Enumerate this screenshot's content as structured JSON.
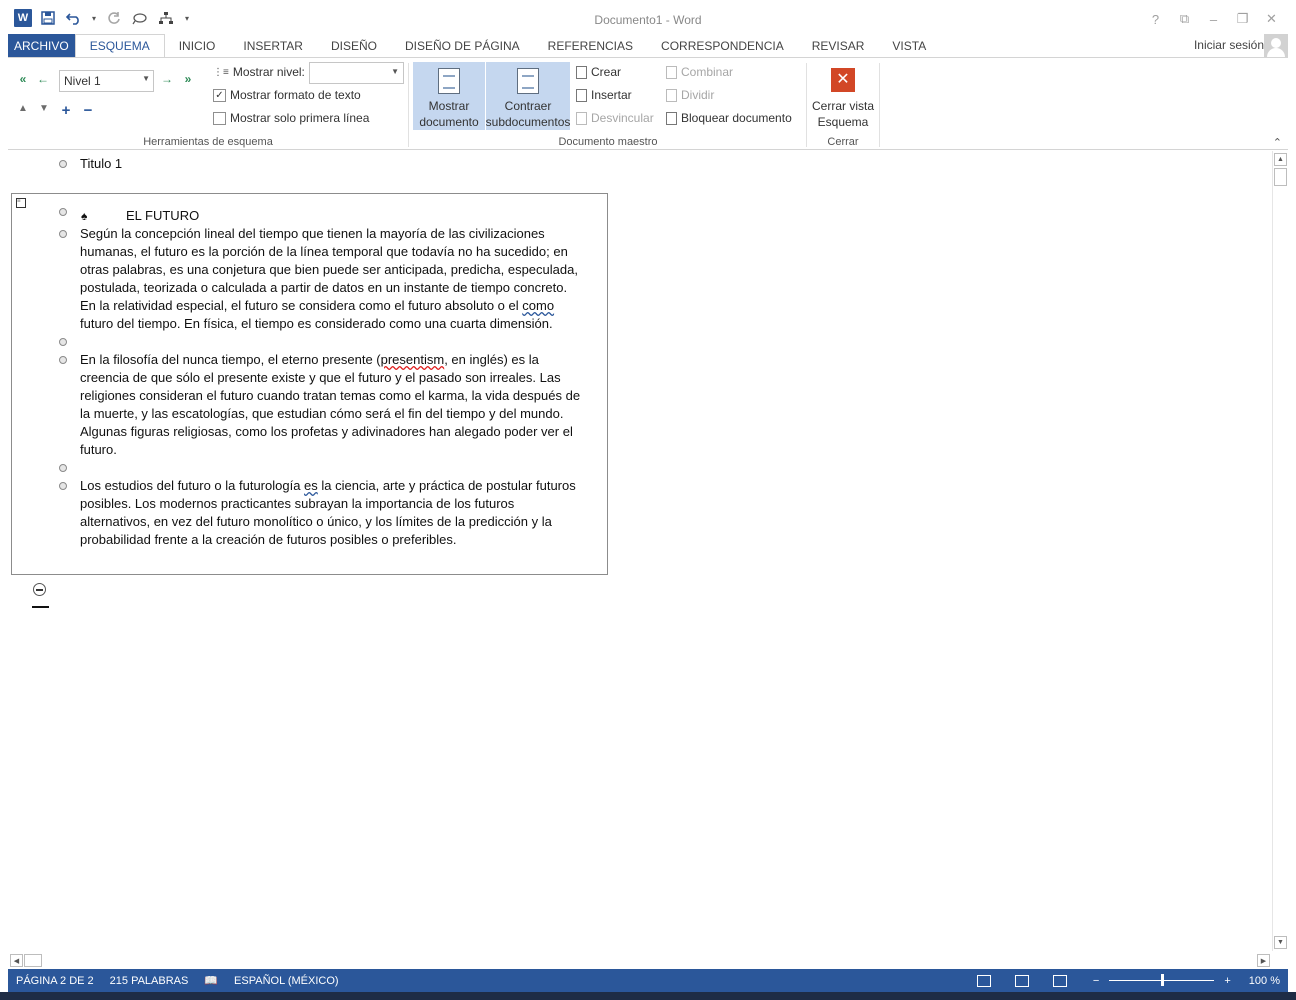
{
  "window": {
    "title": "Documento1 - Word",
    "controls": [
      "?",
      "⧉",
      "–",
      "❐",
      "✕"
    ]
  },
  "qat": {
    "icons": [
      "word-logo-icon",
      "save-icon",
      "undo-icon",
      "redo-icon",
      "touch-mode-icon",
      "org-chart-icon",
      "customize-icon"
    ],
    "word_logo": "W"
  },
  "tabs": [
    {
      "label": "ARCHIVO",
      "kind": "file"
    },
    {
      "label": "ESQUEMA",
      "kind": "active"
    },
    {
      "label": "INICIO"
    },
    {
      "label": "INSERTAR"
    },
    {
      "label": "DISEÑO"
    },
    {
      "label": "DISEÑO DE PÁGINA"
    },
    {
      "label": "REFERENCIAS"
    },
    {
      "label": "CORRESPONDENCIA"
    },
    {
      "label": "REVISAR"
    },
    {
      "label": "VISTA"
    }
  ],
  "account": {
    "signin_label": "Iniciar sesión"
  },
  "ribbon": {
    "outline_tools": {
      "label": "Herramientas de esquema",
      "level_value": "Nivel 1",
      "show_level_label": "Mostrar nivel:",
      "show_format_label": "Mostrar formato de texto",
      "show_format_checked": true,
      "show_first_line_label": "Mostrar solo primera línea",
      "show_first_line_checked": false
    },
    "master_document": {
      "label": "Documento maestro",
      "show_document_label_1": "Mostrar",
      "show_document_label_2": "documento",
      "collapse_label_1": "Contraer",
      "collapse_label_2": "subdocumentos",
      "create_label": "Crear",
      "insert_label": "Insertar",
      "unlink_label": "Desvincular",
      "merge_label": "Combinar",
      "split_label": "Dividir",
      "lock_label": "Bloquear documento"
    },
    "close": {
      "label": "Cerrar",
      "close_view_label_1": "Cerrar vista",
      "close_view_label_2": "Esquema"
    }
  },
  "document": {
    "heading1": "Titulo 1",
    "subdoc_title": "EL FUTURO",
    "para1_lines": [
      "Según la concepción lineal del tiempo que tienen la mayoría de las civilizaciones",
      "humanas, el futuro es la porción de la línea temporal que todavía no ha sucedido; en",
      "otras palabras, es una conjetura que bien puede ser anticipada, predicha, especulada,",
      "postulada, teorizada o calculada a partir de datos en un instante de tiempo concreto.",
      "En la relatividad especial, el futuro se considera como el futuro absoluto o el ",
      "futuro del tiempo. En física, el tiempo es considerado como una cuarta dimensión."
    ],
    "para1_squiggle_word": "como",
    "para2_lines": [
      "En la filosofía del nunca tiempo, el eterno presente (",
      "creencia de que sólo el presente existe y que el futuro y el pasado son irreales. Las",
      "religiones consideran el futuro cuando tratan temas como el karma, la vida después de",
      "la muerte, y las escatologías, que estudian cómo será el fin del tiempo y del mundo.",
      "Algunas figuras religiosas, como los profetas y adivinadores han alegado poder ver el",
      "futuro."
    ],
    "para2_squiggle_word": "presentism",
    "para2_line1_tail": ", en inglés) es la",
    "para3_lines": [
      "Los estudios del futuro o la futurología ",
      "posibles. Los modernos practicantes subrayan la importancia de los futuros",
      "alternativos, en vez del futuro monolítico o único, y los límites de la predicción y la",
      "probabilidad frente a la creación de futuros posibles o preferibles."
    ],
    "para3_squiggle_word": "es",
    "para3_line1_tail": " la ciencia, arte y práctica de postular futuros"
  },
  "statusbar": {
    "page": "PÁGINA 2 DE 2",
    "words": "215 PALABRAS",
    "language": "ESPAÑOL (MÉXICO)",
    "zoom": "100 %"
  },
  "colors": {
    "accent": "#2b579a",
    "close_button": "#d24726",
    "selected_button": "#c5d7ef"
  }
}
